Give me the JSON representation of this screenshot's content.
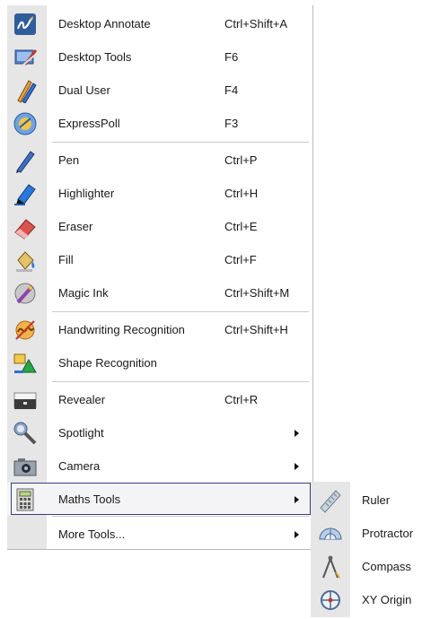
{
  "menu": {
    "items": [
      {
        "name": "desktop-annotate",
        "label": "Desktop Annotate",
        "shortcut": "Ctrl+Shift+A",
        "icon": "pen-swirl-icon",
        "submenu": false
      },
      {
        "name": "desktop-tools",
        "label": "Desktop Tools",
        "shortcut": "F6",
        "icon": "desktop-tools-icon",
        "submenu": false
      },
      {
        "name": "dual-user",
        "label": "Dual User",
        "shortcut": "F4",
        "icon": "dual-pens-icon",
        "submenu": false
      },
      {
        "name": "expresspoll",
        "label": "ExpressPoll",
        "shortcut": "F3",
        "icon": "poll-icon",
        "submenu": false
      },
      {
        "name": "pen",
        "label": "Pen",
        "shortcut": "Ctrl+P",
        "icon": "pen-icon",
        "submenu": false
      },
      {
        "name": "highlighter",
        "label": "Highlighter",
        "shortcut": "Ctrl+H",
        "icon": "highlighter-icon",
        "submenu": false
      },
      {
        "name": "eraser",
        "label": "Eraser",
        "shortcut": "Ctrl+E",
        "icon": "eraser-icon",
        "submenu": false
      },
      {
        "name": "fill",
        "label": "Fill",
        "shortcut": "Ctrl+F",
        "icon": "paint-bucket-icon",
        "submenu": false
      },
      {
        "name": "magic-ink",
        "label": "Magic Ink",
        "shortcut": "Ctrl+Shift+M",
        "icon": "magic-ink-icon",
        "submenu": false
      },
      {
        "name": "handwriting-recognition",
        "label": "Handwriting Recognition",
        "shortcut": "Ctrl+Shift+H",
        "icon": "handwriting-icon",
        "submenu": false
      },
      {
        "name": "shape-recognition",
        "label": "Shape Recognition",
        "shortcut": "",
        "icon": "shapes-icon",
        "submenu": false
      },
      {
        "name": "revealer",
        "label": "Revealer",
        "shortcut": "Ctrl+R",
        "icon": "revealer-icon",
        "submenu": false
      },
      {
        "name": "spotlight",
        "label": "Spotlight",
        "shortcut": "",
        "icon": "spotlight-icon",
        "submenu": true
      },
      {
        "name": "camera",
        "label": "Camera",
        "shortcut": "",
        "icon": "camera-icon",
        "submenu": true
      },
      {
        "name": "maths-tools",
        "label": "Maths Tools",
        "shortcut": "",
        "icon": "calculator-icon",
        "submenu": true,
        "active": true
      },
      {
        "name": "more-tools",
        "label": "More Tools...",
        "shortcut": "",
        "icon": "",
        "submenu": true
      }
    ]
  },
  "submenu": {
    "items": [
      {
        "name": "ruler",
        "label": "Ruler",
        "icon": "ruler-icon"
      },
      {
        "name": "protractor",
        "label": "Protractor",
        "icon": "protractor-icon"
      },
      {
        "name": "compass",
        "label": "Compass",
        "icon": "compass-icon"
      },
      {
        "name": "xy-origin",
        "label": "XY Origin",
        "icon": "xy-origin-icon"
      }
    ]
  }
}
